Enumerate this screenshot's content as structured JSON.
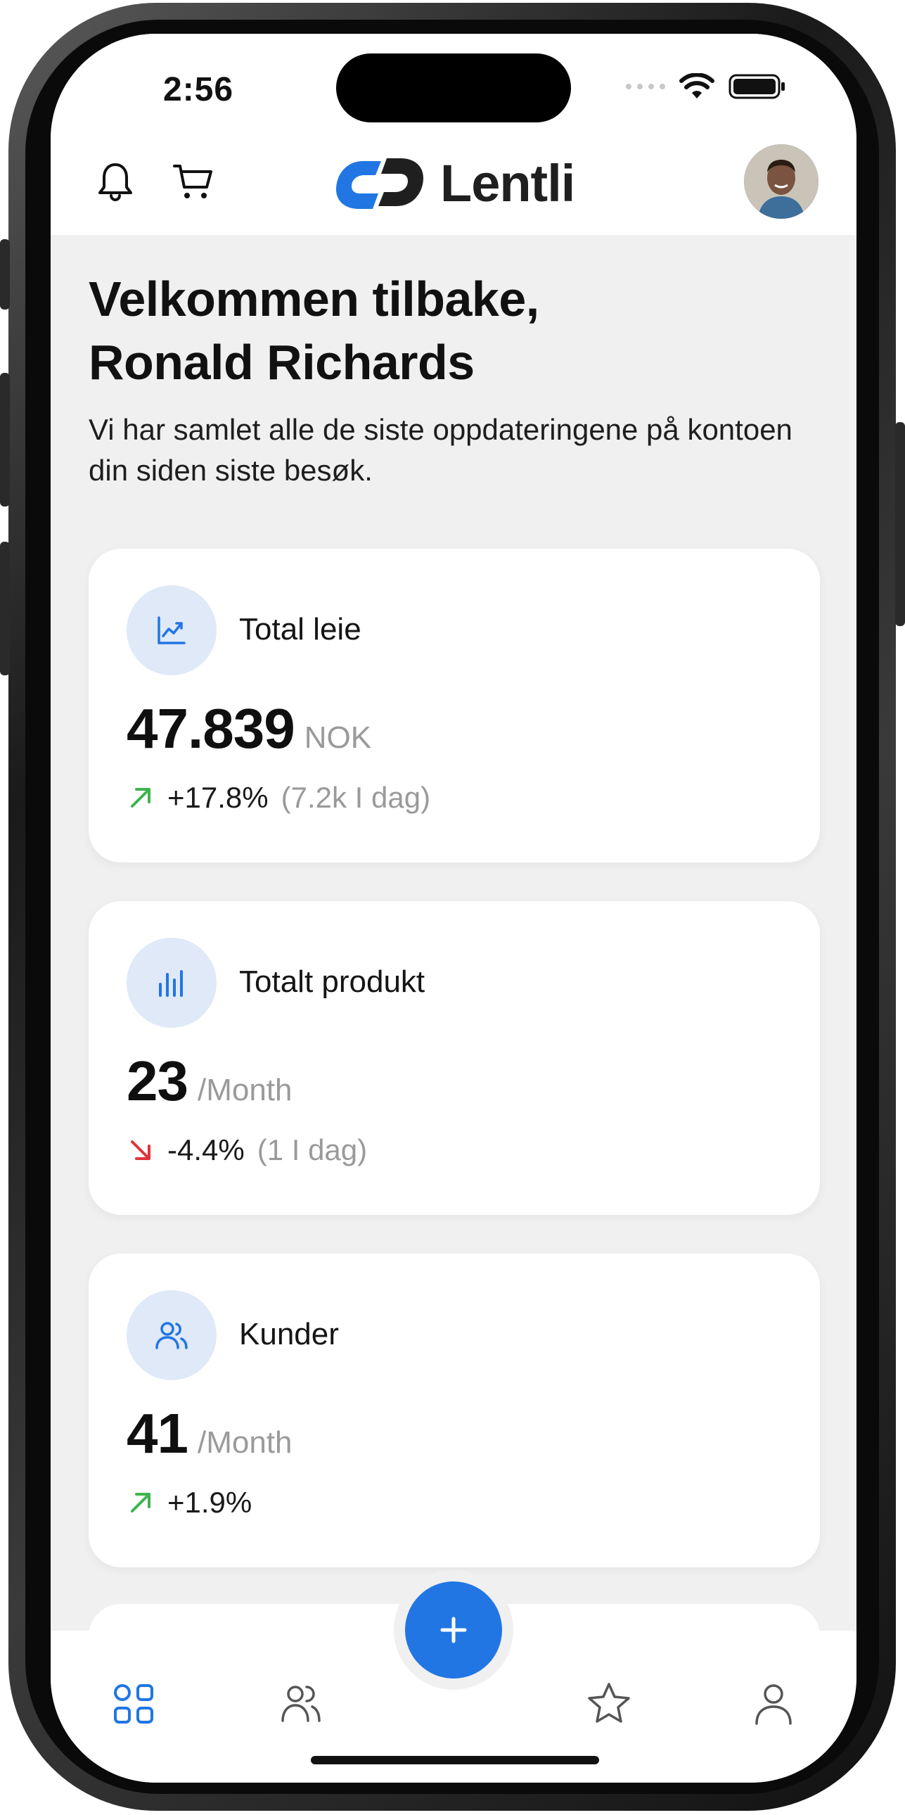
{
  "status_bar": {
    "time": "2:56"
  },
  "header": {
    "brand": "Lentli",
    "icons": [
      "bell-icon",
      "cart-icon"
    ],
    "accent_color": "#2176e3"
  },
  "welcome": {
    "title_line1": "Velkommen tilbake,",
    "title_line2": "Ronald Richards",
    "subtitle": "Vi har samlet alle de siste oppdateringene på kontoen din siden siste besøk."
  },
  "cards": [
    {
      "title": "Total leie",
      "icon": "trend-chart-icon",
      "value": "47.839",
      "unit": "NOK",
      "change": "+17.8%",
      "note": "(7.2k I dag)",
      "direction": "up",
      "color": "#3fb34f"
    },
    {
      "title": "Totalt produkt",
      "icon": "bar-chart-icon",
      "value": "23",
      "unit": "/Month",
      "change": "-4.4%",
      "note": "(1 I dag)",
      "direction": "down",
      "color": "#e0343b"
    },
    {
      "title": "Kunder",
      "icon": "users-icon",
      "value": "41",
      "unit": "/Month",
      "change": "+1.9%",
      "note": "",
      "direction": "up",
      "color": "#3fb34f"
    }
  ],
  "tabbar": {
    "tabs": [
      "dashboard-icon",
      "users-icon",
      "star-icon",
      "profile-icon"
    ],
    "active": "dashboard-icon",
    "fab_icon": "plus-icon"
  }
}
